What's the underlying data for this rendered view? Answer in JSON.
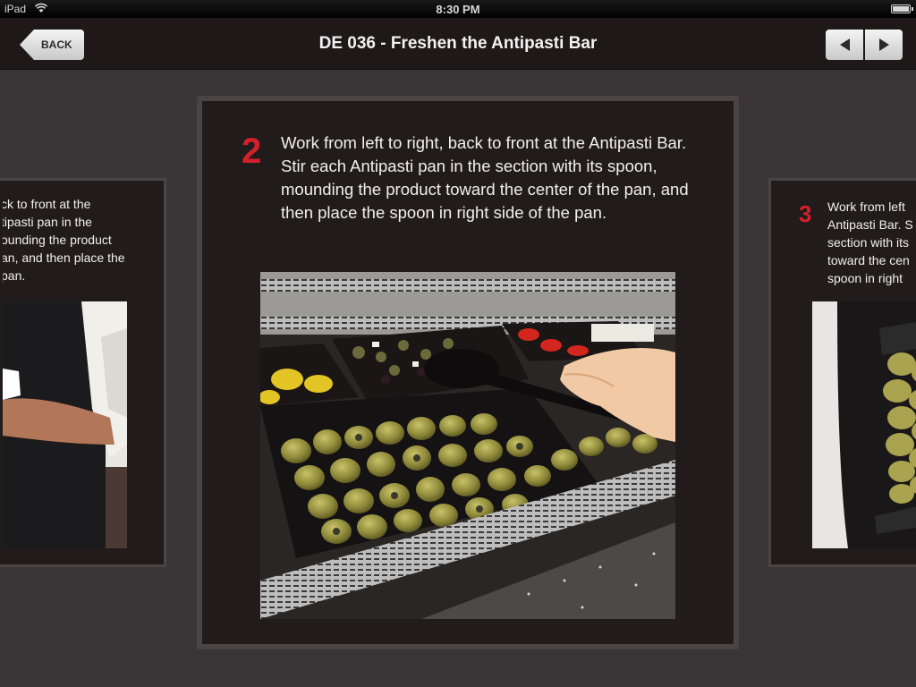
{
  "status_bar": {
    "device": "iPad",
    "time": "8:30 PM"
  },
  "nav": {
    "back_label": "BACK",
    "title": "DE 036 - Freshen the Antipasti Bar"
  },
  "steps": {
    "previous": {
      "visible_lines": [
        "ck to front at the",
        "tipasti pan in the",
        "ounding the product",
        "an, and then place the",
        "pan."
      ]
    },
    "current": {
      "number": "2",
      "text": "Work from left to right, back to front at the Antipasti Bar. Stir each Antipasti pan in the section with its spoon, mounding the product toward the center of the pan, and then place the spoon in right side of the pan."
    },
    "next": {
      "number": "3",
      "visible_lines": [
        "Work from left",
        "Antipasti Bar. S",
        "section with its",
        "toward the cen",
        "spoon in right"
      ]
    }
  },
  "colors": {
    "accent_red": "#d4202a",
    "card_bg": "#221b1c",
    "nav_bg": "#1f1819",
    "page_bg": "#3a3536"
  },
  "icons": {
    "prev": "left-arrow-icon",
    "next": "right-arrow-icon",
    "wifi": "wifi-icon",
    "battery": "battery-icon"
  }
}
